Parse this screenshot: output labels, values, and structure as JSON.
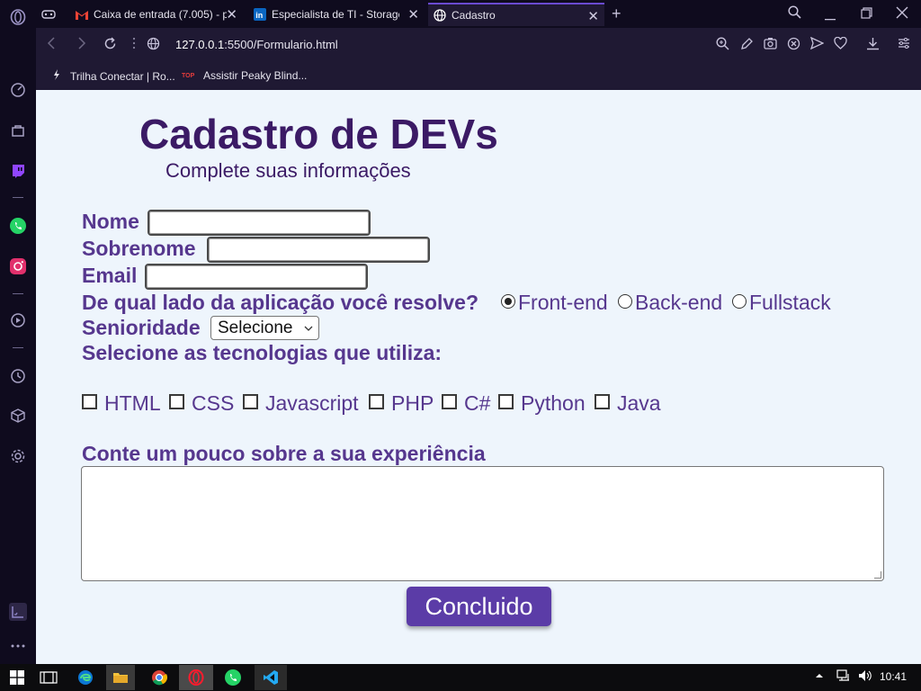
{
  "browser": {
    "tabs": [
      {
        "label": "Caixa de entrada (7.005) - p",
        "icon": "gmail-icon"
      },
      {
        "label": "Especialista de TI - Storage",
        "icon": "linkedin-icon"
      },
      {
        "label": "Cadastro",
        "icon": "globe-icon",
        "active": true
      }
    ],
    "address": {
      "host": "127.0.0.1",
      "rest": ":5500/Formulario.html"
    },
    "bookmarks": [
      {
        "label": "Trilha Conectar | Ro..."
      },
      {
        "label": "Assistir Peaky Blind...",
        "badge": "TOP"
      }
    ]
  },
  "form": {
    "title": "Cadastro de DEVs",
    "subtitle": "Complete suas informações",
    "fields": {
      "nome": {
        "label": "Nome",
        "value": ""
      },
      "sobrenome": {
        "label": "Sobrenome",
        "value": ""
      },
      "email": {
        "label": "Email",
        "value": ""
      }
    },
    "side_question": "De qual lado da aplicação você resolve?",
    "side_options": [
      "Front-end",
      "Back-end",
      "Fullstack"
    ],
    "side_selected": "Front-end",
    "seniority": {
      "label": "Senioridade",
      "selected": "Selecione"
    },
    "tech_question": "Selecione as tecnologias que utiliza:",
    "technologies": [
      "HTML",
      "CSS",
      "Javascript",
      "PHP",
      "C#",
      "Python",
      "Java"
    ],
    "experience_label": "Conte um pouco sobre a sua experiência",
    "experience_value": "",
    "submit_label": "Concluido"
  },
  "taskbar": {
    "clock": "10:41"
  },
  "colors": {
    "accent": "#6a4bd1",
    "form_text": "#56378e",
    "title": "#3b1a65",
    "button": "#5b3ca7",
    "page_bg": "#eef5fc"
  }
}
